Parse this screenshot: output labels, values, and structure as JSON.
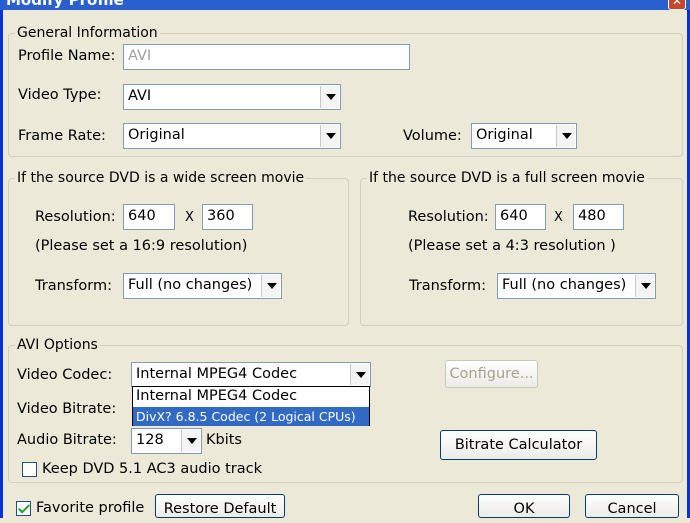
{
  "window": {
    "title": "Modify Profile"
  },
  "general": {
    "legend": "General Information",
    "profile_name_label": "Profile Name:",
    "profile_name_value": "AVI",
    "video_type_label": "Video Type:",
    "video_type_value": "AVI",
    "frame_rate_label": "Frame Rate:",
    "frame_rate_value": "Original",
    "volume_label": "Volume:",
    "volume_value": "Original"
  },
  "wide": {
    "legend": "If the source DVD is a wide screen movie",
    "resolution_label": "Resolution:",
    "width": "640",
    "x": "X",
    "height": "360",
    "hint": "(Please set a 16:9 resolution)",
    "transform_label": "Transform:",
    "transform_value": "Full (no changes)"
  },
  "full": {
    "legend": "If the source DVD is a full screen movie",
    "resolution_label": "Resolution:",
    "width": "640",
    "x": "X",
    "height": "480",
    "hint": "(Please set a 4:3 resolution )",
    "transform_label": "Transform:",
    "transform_value": "Full (no changes)"
  },
  "avi": {
    "legend": "AVI Options",
    "video_codec_label": "Video Codec:",
    "video_codec_value": "Internal MPEG4 Codec",
    "codec_options": [
      "Internal MPEG4 Codec",
      "DivX? 6.8.5 Codec (2 Logical CPUs)"
    ],
    "configure_label": "Configure...",
    "video_bitrate_label": "Video Bitrate:",
    "audio_bitrate_label": "Audio Bitrate:",
    "audio_bitrate_value": "128",
    "audio_bitrate_unit": "Kbits",
    "bitrate_calc_label": "Bitrate Calculator",
    "keep_ac3_label": "Keep DVD 5.1 AC3 audio track",
    "keep_ac3_checked": false
  },
  "footer": {
    "favorite_label": "Favorite profile",
    "favorite_checked": true,
    "restore_label": "Restore Default",
    "ok_label": "OK",
    "cancel_label": "Cancel"
  }
}
